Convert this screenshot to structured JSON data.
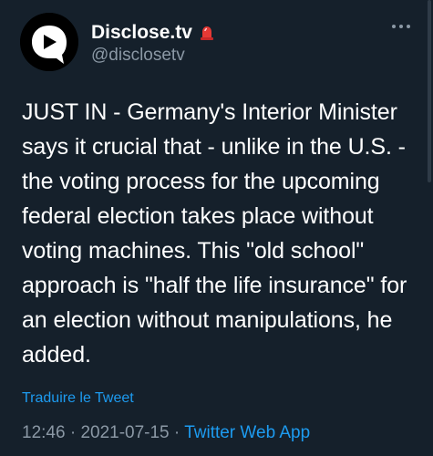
{
  "author": {
    "display_name": "Disclose.tv",
    "handle": "@disclosetv",
    "avatar_icon": "disclose-logo-icon",
    "badge_icon": "siren-icon"
  },
  "tweet": {
    "text": "JUST IN - Germany's Interior Minister says it crucial that - unlike in the U.S. - the voting process for the upcoming federal election takes place without voting machines. This \"old school\" approach is \"half the life insurance\" for an election without manipulations, he added.",
    "translate_label": "Traduire le Tweet",
    "time": "12:46",
    "separator1": " · ",
    "date": "2021-07-15",
    "separator2": " · ",
    "source": "Twitter Web App"
  },
  "colors": {
    "background": "#15202b",
    "text": "#ffffff",
    "secondary": "#8b98a5",
    "link": "#1d9bf0"
  }
}
